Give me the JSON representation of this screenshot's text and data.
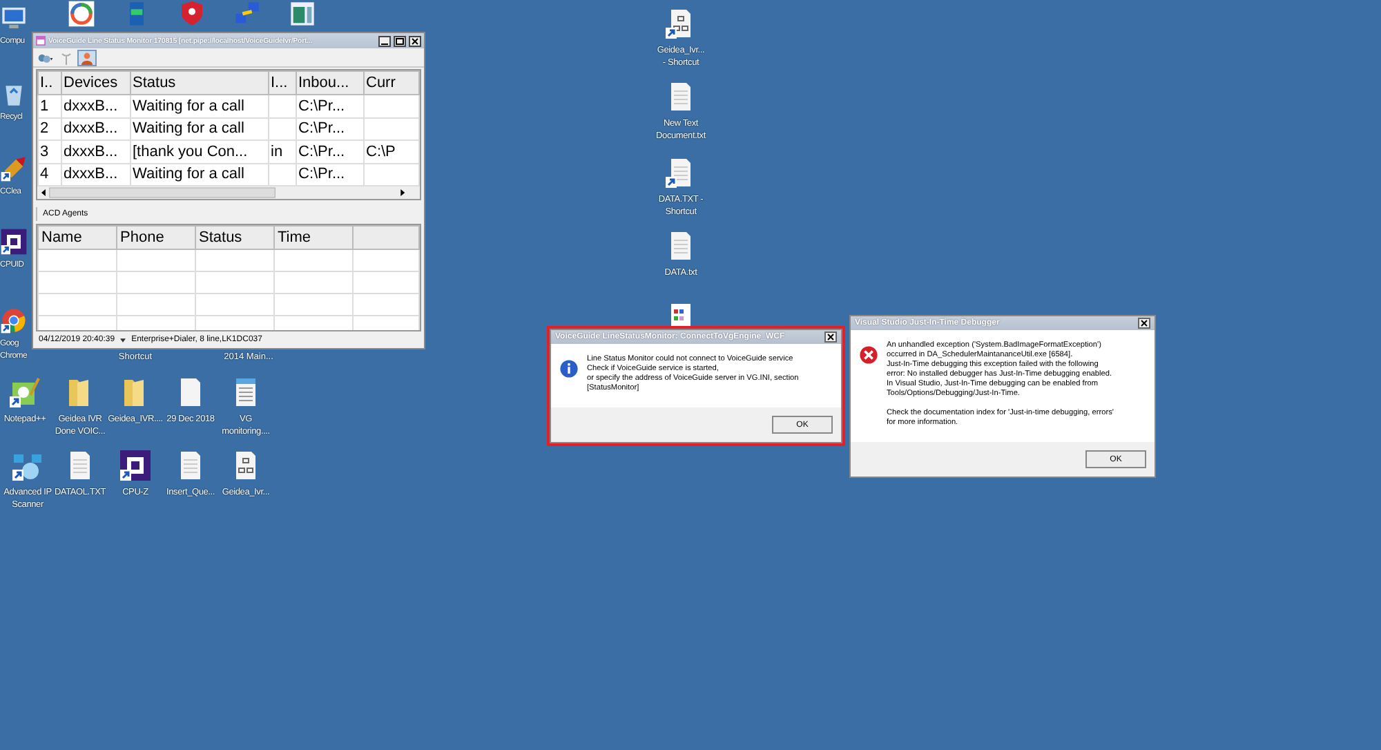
{
  "desktop": {
    "icons": [
      {
        "kind": "computer",
        "lines": [
          "Compu"
        ],
        "shortcut": false
      },
      {
        "kind": "ring-app",
        "shortcut": false
      },
      {
        "kind": "card",
        "shortcut": false
      },
      {
        "kind": "shield",
        "shortcut": false
      },
      {
        "kind": "network",
        "shortcut": false
      },
      {
        "kind": "window-app",
        "shortcut": false
      },
      {
        "kind": "recycle",
        "lines": [
          "Recycl"
        ],
        "shortcut": false
      },
      {
        "kind": "ccleaner",
        "lines": [
          "CClea"
        ],
        "shortcut": true
      },
      {
        "kind": "chip",
        "lines": [
          "CPUID"
        ],
        "shortcut": true
      },
      {
        "kind": "chrome",
        "lines": [
          "Goog",
          "Chrome"
        ],
        "shortcut": true
      },
      {
        "kind": "notepad",
        "lines": [
          "Notepad++"
        ],
        "shortcut": true
      },
      {
        "kind": "folder",
        "lines": [
          "Geidea IVR",
          "Done VOIC..."
        ],
        "shortcut": false
      },
      {
        "kind": "folder",
        "lines": [
          "Geidea_IVR...."
        ],
        "shortcut": false
      },
      {
        "kind": "blank",
        "lines": [
          "29 Dec 2018"
        ],
        "shortcut": false
      },
      {
        "kind": "config",
        "lines": [
          "VG",
          "monitoring...."
        ],
        "shortcut": false
      },
      {
        "kind": "scanner",
        "lines": [
          "Advanced IP",
          "Scanner"
        ],
        "shortcut": true
      },
      {
        "kind": "text",
        "lines": [
          "DATAOL.TXT"
        ],
        "shortcut": false
      },
      {
        "kind": "chip",
        "lines": [
          "CPU-Z"
        ],
        "shortcut": true
      },
      {
        "kind": "text",
        "lines": [
          "Insert_Que..."
        ],
        "shortcut": false
      },
      {
        "kind": "diagram",
        "lines": [
          "Geidea_Ivr..."
        ],
        "shortcut": false
      },
      {
        "kind": "diagram",
        "lines": [
          "Geidea_Ivr...",
          "- Shortcut"
        ],
        "shortcut": true
      },
      {
        "kind": "text",
        "lines": [
          "New Text",
          "Document.txt"
        ],
        "shortcut": false
      },
      {
        "kind": "text",
        "lines": [
          "DATA.TXT -",
          "Shortcut"
        ],
        "shortcut": true
      },
      {
        "kind": "text",
        "lines": [
          "DATA.txt"
        ],
        "shortcut": false
      },
      {
        "kind": "sheet",
        "shortcut": false
      }
    ],
    "partial_labels": [
      "Shortcut",
      "2014 Main..."
    ]
  },
  "monitor": {
    "title": "VoiceGuide Line Status Monitor 170815 [net.pipe://localhost/VoiceGuideIvr/Port...",
    "lines_table": {
      "columns": [
        "I..",
        "Devices",
        "Status",
        "I...",
        "Inbou...",
        "Curr"
      ],
      "rows": [
        [
          "1",
          "dxxxB...",
          "Waiting for a call",
          "",
          "C:\\Pr...",
          ""
        ],
        [
          "2",
          "dxxxB...",
          "Waiting for a call",
          "",
          "C:\\Pr...",
          ""
        ],
        [
          "3",
          "dxxxB...",
          "[thank you Con...",
          "in",
          "C:\\Pr...",
          "C:\\P"
        ],
        [
          "4",
          "dxxxB...",
          "Waiting for a call",
          "",
          "C:\\Pr...",
          ""
        ]
      ]
    },
    "agents_label": "ACD Agents",
    "agents_table": {
      "columns": [
        "Name",
        "Phone",
        "Status",
        "Time"
      ]
    },
    "status_bar": {
      "time": "04/12/2019 20:40:39",
      "info": "Enterprise+Dialer, 8 line,LK1DC037"
    }
  },
  "dialogs": [
    {
      "title": "VoiceGuide LineStatusMonitor: ConnectToVgEngine_WCF",
      "kind": "info",
      "highlighted": true,
      "paragraphs": [
        [
          "Line Status Monitor could not connect to VoiceGuide service",
          "Check if VoiceGuide service is started,",
          "or specify the address of VoiceGuide server in VG.INI, section",
          "[StatusMonitor]"
        ]
      ],
      "button": "OK"
    },
    {
      "title": "Visual Studio Just-In-Time Debugger",
      "kind": "error",
      "highlighted": false,
      "paragraphs": [
        [
          "An unhandled exception ('System.BadImageFormatException')",
          "occurred in DA_SchedulerMaintananceUtil.exe [6584].",
          "Just-In-Time debugging this exception failed with the following",
          "error: No installed debugger has Just-In-Time debugging enabled.",
          "In Visual Studio, Just-In-Time debugging can be enabled from",
          "Tools/Options/Debugging/Just-In-Time."
        ],
        [
          "Check the documentation index for 'Just-in-time debugging, errors'",
          "for more information."
        ]
      ],
      "button": "OK"
    }
  ]
}
